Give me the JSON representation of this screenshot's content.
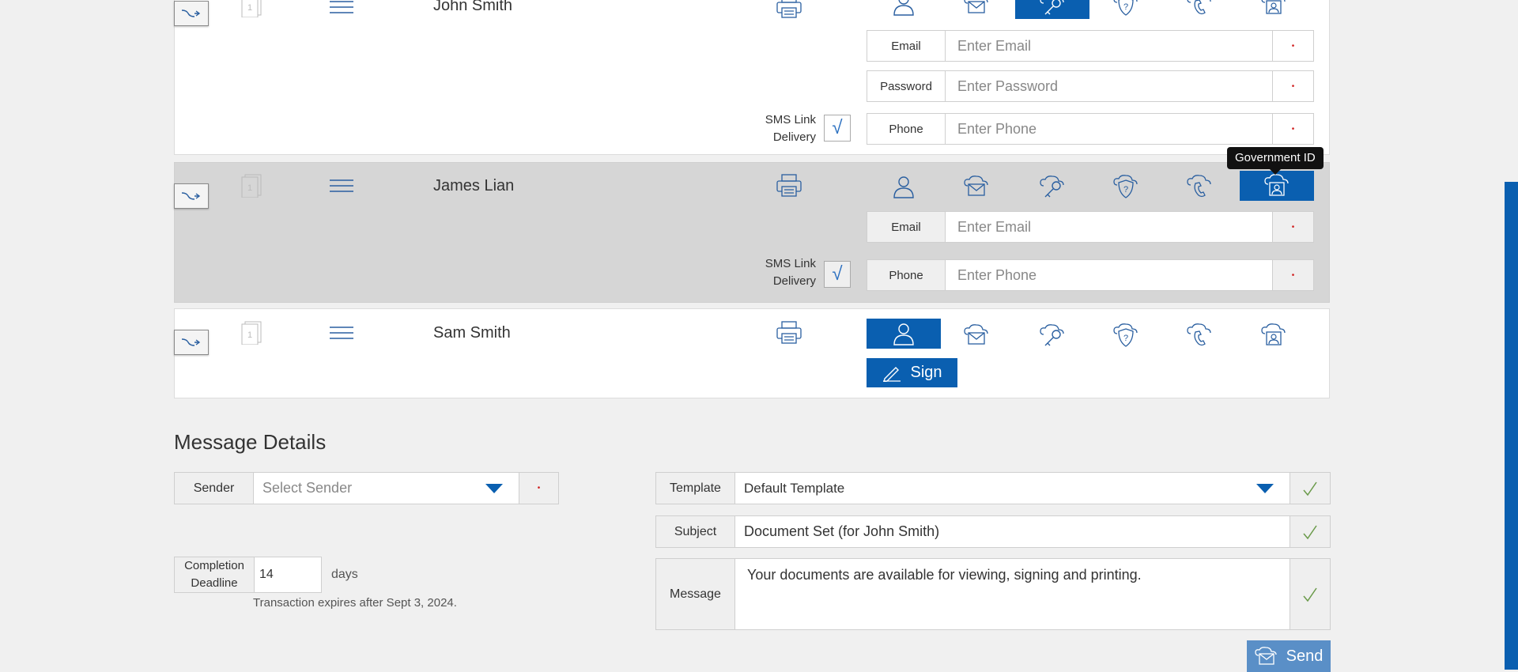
{
  "recipients": [
    {
      "name": "John Smith",
      "doc_number": "1",
      "auth_fields": [
        {
          "label": "Email",
          "placeholder": "Enter Email",
          "required": "•"
        },
        {
          "label": "Password",
          "placeholder": "Enter Password",
          "required": "•"
        },
        {
          "label": "Phone",
          "placeholder": "Enter Phone",
          "required": "•"
        }
      ],
      "sms_label_1": "SMS Link",
      "sms_label_2": "Delivery",
      "sms_checked": "√"
    },
    {
      "name": "James Lian",
      "doc_number": "1",
      "auth_fields": [
        {
          "label": "Email",
          "placeholder": "Enter Email",
          "required": "•"
        },
        {
          "label": "Phone",
          "placeholder": "Enter Phone",
          "required": "•"
        }
      ],
      "sms_label_1": "SMS Link",
      "sms_label_2": "Delivery",
      "sms_checked": "√",
      "tooltip": "Government ID"
    },
    {
      "name": "Sam Smith",
      "doc_number": "1",
      "sign_label": "Sign"
    }
  ],
  "auth_icons": [
    "user-icon",
    "cloud-mail-icon",
    "cloud-key-icon",
    "cloud-question-icon",
    "cloud-phone-icon",
    "cloud-id-icon"
  ],
  "message_details": {
    "title": "Message Details",
    "sender_label": "Sender",
    "sender_placeholder": "Select Sender",
    "sender_required": "•",
    "template_label": "Template",
    "template_value": "Default Template",
    "subject_label": "Subject",
    "subject_value": "Document Set (for John Smith)",
    "message_label": "Message",
    "message_value": "Your documents are available for viewing, signing and printing.",
    "deadline_label_1": "Completion",
    "deadline_label_2": "Deadline",
    "deadline_value": "14",
    "deadline_unit": "days",
    "expiry_text": "Transaction expires after Sept 3, 2024.",
    "send_label": "Send"
  },
  "colors": {
    "accent": "#0a5fb0",
    "required": "#d02020",
    "ok": "#6a9a4a"
  }
}
